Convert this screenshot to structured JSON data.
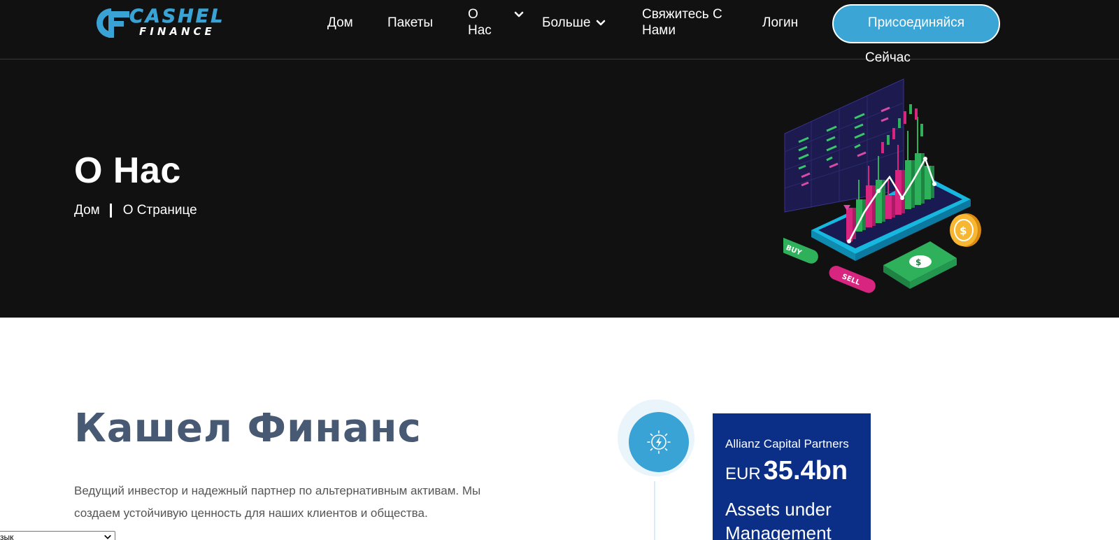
{
  "header": {
    "logo": {
      "word1": "CASHEL",
      "word2": "FINANCE"
    },
    "nav": {
      "home": "Дом",
      "packages": "Пакеты",
      "about_line1": "О",
      "about_line2": "Нас",
      "more": "Больше",
      "contact_line1": "Свяжитесь С",
      "contact_line2": "Нами",
      "login": "Логин"
    },
    "join_button": {
      "line1": "Присоединяйся",
      "line2": "Сейчас"
    },
    "colors": {
      "background": "#111111",
      "accent": "#3aa3d6"
    }
  },
  "hero": {
    "title": "О Нас",
    "breadcrumb": {
      "home": "Дом",
      "current": "О Странице"
    },
    "illustration": {
      "buy_label": "BUY",
      "sell_label": "SELL"
    }
  },
  "about": {
    "title": "Кашел Финанс",
    "text": "Ведущий инвестор и надежный партнер по альтернативным активам. Мы создаем устойчивую ценность для наших клиентов и общества.",
    "icon": "lightning-bulb-icon",
    "card": {
      "line1": "Allianz Capital Partners",
      "currency": "EUR",
      "amount": "35.4bn",
      "line3": "Assets under",
      "line4": "Management"
    },
    "title_color": "#485a73"
  },
  "language_select": {
    "label": "зык"
  }
}
